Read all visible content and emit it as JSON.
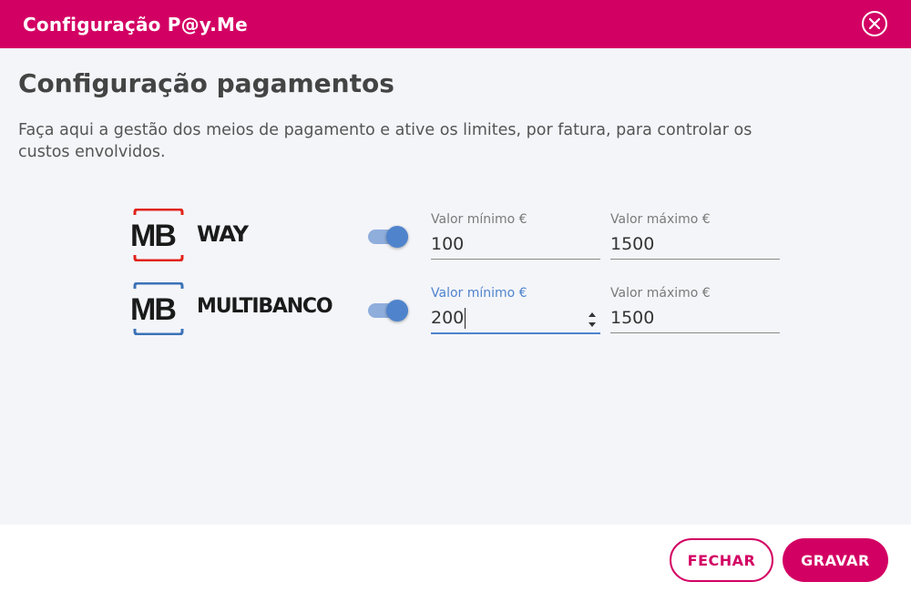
{
  "header": {
    "title": "Configuração P@y.Me",
    "close_icon": "close-circle-icon"
  },
  "main": {
    "title": "Configuração pagamentos",
    "description": "Faça aqui a gestão dos meios de pagamento e ative os limites, por fatura, para controlar os custos envolvidos."
  },
  "methods": [
    {
      "logo_mark": "MB",
      "logo_text": "WAY",
      "logo_color": "#e2231a",
      "enabled": true,
      "min_label": "Valor mínimo €",
      "min_value": "100",
      "max_label": "Valor máximo €",
      "max_value": "1500"
    },
    {
      "logo_mark": "MB",
      "logo_text": "MULTIBANCO",
      "logo_color": "#3c72b8",
      "enabled": true,
      "min_label": "Valor mínimo €",
      "min_value": "200",
      "max_label": "Valor máximo €",
      "max_value": "1500"
    }
  ],
  "footer": {
    "close_label": "FECHAR",
    "save_label": "GRAVAR"
  },
  "colors": {
    "brand": "#d30063",
    "toggle_on": "#4f84cd",
    "focus": "#4f84cd"
  }
}
